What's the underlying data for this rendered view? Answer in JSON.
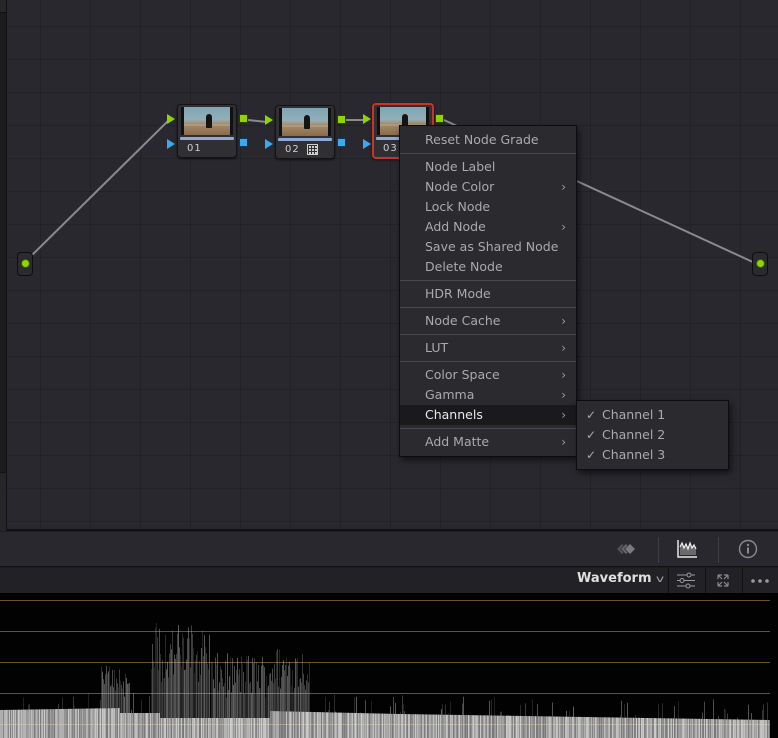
{
  "node_editor": {
    "nodes": [
      {
        "id": "01",
        "label": "01",
        "selected": false,
        "has_grid_icon": false
      },
      {
        "id": "02",
        "label": "02",
        "selected": false,
        "has_grid_icon": true
      },
      {
        "id": "03",
        "label": "03",
        "selected": true,
        "has_grid_icon": false
      }
    ],
    "input_node": {
      "icon": "source-input-dot"
    },
    "output_node": {
      "icon": "output-dot"
    },
    "colors": {
      "rgb_connector": "#8fd400",
      "alpha_connector": "#3aa9f0",
      "selected_border": "#c9332e"
    }
  },
  "context_menu": {
    "groups": [
      [
        {
          "label": "Reset Node Grade",
          "submenu": false
        }
      ],
      [
        {
          "label": "Node Label",
          "submenu": false
        },
        {
          "label": "Node Color",
          "submenu": true
        },
        {
          "label": "Lock Node",
          "submenu": false
        },
        {
          "label": "Add Node",
          "submenu": true
        },
        {
          "label": "Save as Shared Node",
          "submenu": false
        },
        {
          "label": "Delete Node",
          "submenu": false
        }
      ],
      [
        {
          "label": "HDR Mode",
          "submenu": false
        }
      ],
      [
        {
          "label": "Node Cache",
          "submenu": true
        }
      ],
      [
        {
          "label": "LUT",
          "submenu": true
        }
      ],
      [
        {
          "label": "Color Space",
          "submenu": true
        },
        {
          "label": "Gamma",
          "submenu": true
        },
        {
          "label": "Channels",
          "submenu": true,
          "active": true
        }
      ],
      [
        {
          "label": "Add Matte",
          "submenu": true
        }
      ]
    ],
    "chevron": "›"
  },
  "channels_submenu": {
    "items": [
      {
        "label": "Channel 1",
        "checked": true
      },
      {
        "label": "Channel 2",
        "checked": true
      },
      {
        "label": "Channel 3",
        "checked": true
      }
    ],
    "check_glyph": "✓"
  },
  "viewer_toolbar": {
    "buttons": [
      {
        "name": "gallery-stills-icon"
      },
      {
        "name": "scopes-icon",
        "active": true
      },
      {
        "name": "info-icon"
      }
    ]
  },
  "scope_header": {
    "scope_type": "Waveform",
    "chevron": "⌄",
    "buttons": [
      {
        "name": "scope-settings-icon"
      },
      {
        "name": "expand-icon"
      },
      {
        "name": "more-options-icon",
        "glyph": "•••"
      }
    ]
  },
  "waveform": {
    "graticule_color": "#6b5326",
    "graticule_lines": 5
  }
}
